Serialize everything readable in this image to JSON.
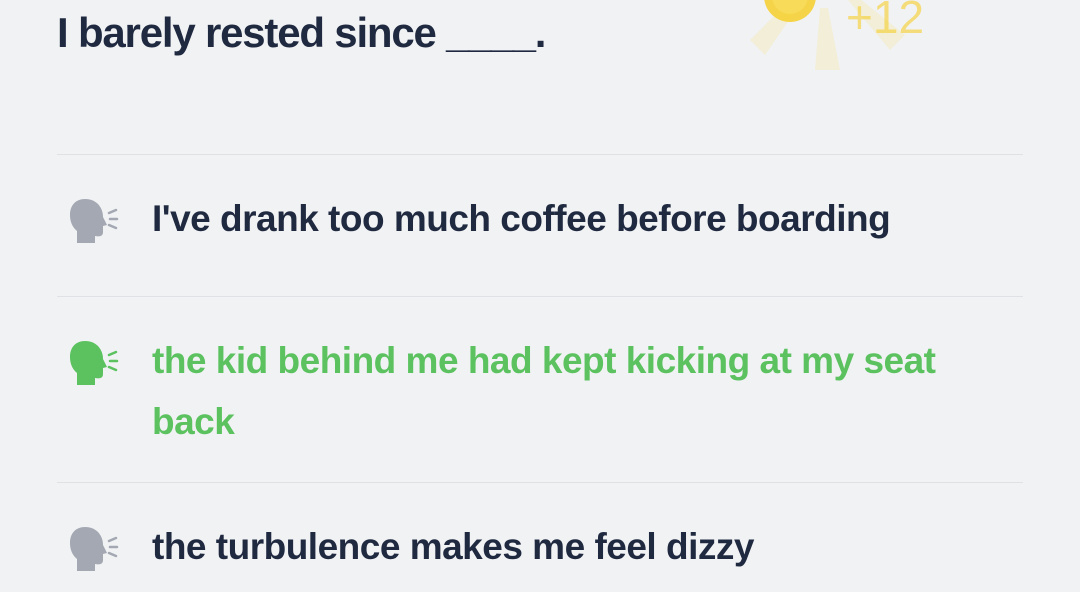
{
  "question": {
    "text": "I barely rested since ____."
  },
  "reward": {
    "label": "+12",
    "icon": "sun-coin-icon",
    "color": "#f6d13a"
  },
  "options": [
    {
      "text": "I've drank too much coffee before boarding",
      "selected": false,
      "icon": "speaking-head-icon"
    },
    {
      "text": "the kid behind me had kept kicking at my seat back",
      "selected": true,
      "icon": "speaking-head-icon"
    },
    {
      "text": "the turbulence makes me feel dizzy",
      "selected": false,
      "icon": "speaking-head-icon"
    }
  ],
  "colors": {
    "text": "#1f2940",
    "selected": "#5bc25f",
    "icon_default": "#a3a8b2",
    "background": "#f1f2f4"
  }
}
